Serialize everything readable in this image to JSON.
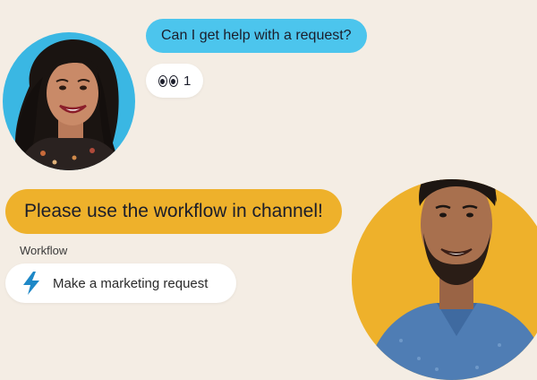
{
  "messages": {
    "question": "Can I get help with a request?",
    "reaction": {
      "icon": "eyes-icon",
      "count": "1"
    },
    "answer": "Please use the workflow in channel!"
  },
  "workflow": {
    "section_label": "Workflow",
    "button_label": "Make a marketing request",
    "icon": "lightning-icon",
    "icon_color": "#1e88c7"
  },
  "colors": {
    "background": "#f4ede4",
    "question_bubble": "#4cc5ed",
    "answer_bubble": "#eeb12b",
    "avatar_woman_bg": "#3ab7e3",
    "avatar_man_bg": "#eeb12b"
  }
}
